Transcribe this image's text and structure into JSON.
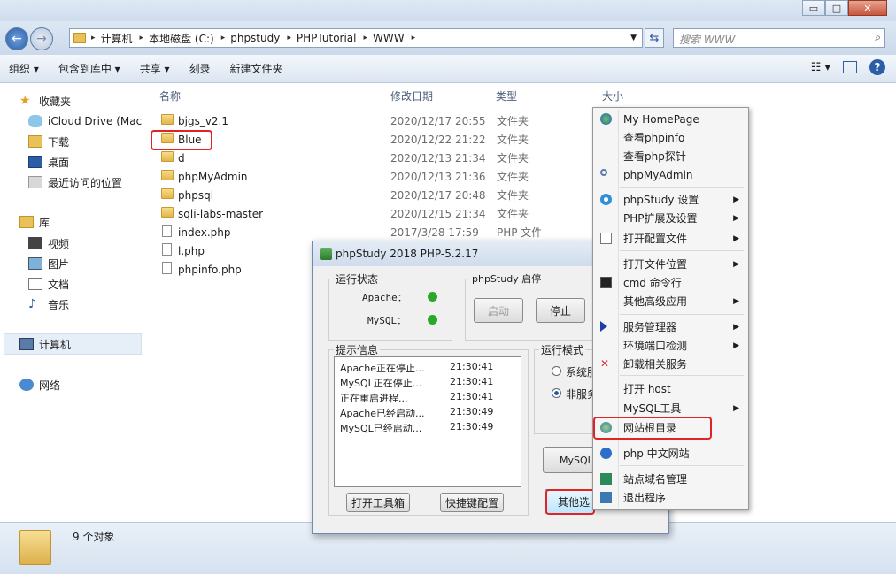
{
  "explorer": {
    "address": {
      "crumbs": [
        "计算机",
        "本地磁盘 (C:)",
        "phpstudy",
        "PHPTutorial",
        "WWW"
      ]
    },
    "search_placeholder": "搜索 WWW",
    "toolbar": {
      "organize": "组织 ▾",
      "include": "包含到库中 ▾",
      "share": "共享 ▾",
      "burn": "刻录",
      "new_folder": "新建文件夹"
    },
    "sidebar": [
      {
        "label": "收藏夹",
        "icon": "star-icon"
      },
      {
        "label": "iCloud Drive (Mac)",
        "icon": "cloud-icon"
      },
      {
        "label": "下载",
        "icon": "folder-icon"
      },
      {
        "label": "桌面",
        "icon": "desktop-icon"
      },
      {
        "label": "最近访问的位置",
        "icon": "recent-icon"
      },
      {
        "label": "库",
        "icon": "library-icon"
      },
      {
        "label": "视频",
        "icon": "video-icon"
      },
      {
        "label": "图片",
        "icon": "picture-icon"
      },
      {
        "label": "文档",
        "icon": "document-icon"
      },
      {
        "label": "音乐",
        "icon": "music-icon"
      },
      {
        "label": "计算机",
        "icon": "computer-icon"
      },
      {
        "label": "网络",
        "icon": "network-icon"
      }
    ],
    "columns": {
      "name": "名称",
      "date": "修改日期",
      "type": "类型",
      "size": "大小"
    },
    "files": [
      {
        "name": "bjgs_v2.1",
        "date": "2020/12/17 20:55",
        "type": "文件夹",
        "kind": "folder"
      },
      {
        "name": "Blue",
        "date": "2020/12/22 21:22",
        "type": "文件夹",
        "kind": "folder"
      },
      {
        "name": "d",
        "date": "2020/12/13 21:34",
        "type": "文件夹",
        "kind": "folder"
      },
      {
        "name": "phpMyAdmin",
        "date": "2020/12/13 21:36",
        "type": "文件夹",
        "kind": "folder"
      },
      {
        "name": "phpsql",
        "date": "2020/12/17 20:48",
        "type": "文件夹",
        "kind": "folder"
      },
      {
        "name": "sqli-labs-master",
        "date": "2020/12/15 21:34",
        "type": "文件夹",
        "kind": "folder"
      },
      {
        "name": "index.php",
        "date": "2017/3/28 17:59",
        "type": "PHP 文件",
        "kind": "file"
      },
      {
        "name": "l.php",
        "date": "",
        "type": "",
        "kind": "file"
      },
      {
        "name": "phpinfo.php",
        "date": "",
        "type": "",
        "kind": "file"
      }
    ],
    "status": "9 个对象"
  },
  "phpstudy": {
    "title": "phpStudy 2018   PHP-5.2.17",
    "run_status": "运行状态",
    "apache": "Apache：",
    "mysql": "MySQL：",
    "start_stop": "phpStudy 启停",
    "start_btn": "启动",
    "stop_btn": "停止",
    "info_title": "提示信息",
    "log": [
      {
        "msg": "Apache正在停止...",
        "time": "21:30:41"
      },
      {
        "msg": "MySQL正在停止...",
        "time": "21:30:41"
      },
      {
        "msg": "正在重启进程...",
        "time": "21:30:41"
      },
      {
        "msg": "Apache已经启动...",
        "time": "21:30:49"
      },
      {
        "msg": "MySQL已经启动...",
        "time": "21:30:49"
      }
    ],
    "run_mode": "运行模式",
    "mode_system": "系统服",
    "mode_nonservice": "非服务",
    "toolbox_btn": "打开工具箱",
    "hotkey_btn": "快捷键配置",
    "mysql_btn": "MySQL",
    "other_btn": "其他选"
  },
  "menu": [
    {
      "label": "My HomePage",
      "icon": "globe-icon",
      "sub": false
    },
    {
      "label": "查看phpinfo",
      "icon": "",
      "sub": false
    },
    {
      "label": "查看php探针",
      "icon": "",
      "sub": false
    },
    {
      "label": "phpMyAdmin",
      "icon": "link-icon",
      "sub": false
    },
    {
      "label": "phpStudy 设置",
      "icon": "gear-icon",
      "sub": true
    },
    {
      "label": "PHP扩展及设置",
      "icon": "",
      "sub": true
    },
    {
      "label": "打开配置文件",
      "icon": "config-icon",
      "sub": true
    },
    {
      "label": "打开文件位置",
      "icon": "",
      "sub": true
    },
    {
      "label": "cmd 命令行",
      "icon": "terminal-icon",
      "sub": false
    },
    {
      "label": "其他高级应用",
      "icon": "",
      "sub": true
    },
    {
      "label": "服务管理器",
      "icon": "play-icon",
      "sub": true
    },
    {
      "label": "环境端口检测",
      "icon": "",
      "sub": true
    },
    {
      "label": "卸载相关服务",
      "icon": "uninstall-icon",
      "sub": false
    },
    {
      "label": "打开 host",
      "icon": "",
      "sub": false
    },
    {
      "label": "MySQL工具",
      "icon": "",
      "sub": true
    },
    {
      "label": "网站根目录",
      "icon": "web-root-icon",
      "sub": false
    },
    {
      "label": "php 中文网站",
      "icon": "help-icon",
      "sub": false
    },
    {
      "label": "站点域名管理",
      "icon": "sitemap-icon",
      "sub": false
    },
    {
      "label": "退出程序",
      "icon": "exit-icon",
      "sub": false
    }
  ]
}
